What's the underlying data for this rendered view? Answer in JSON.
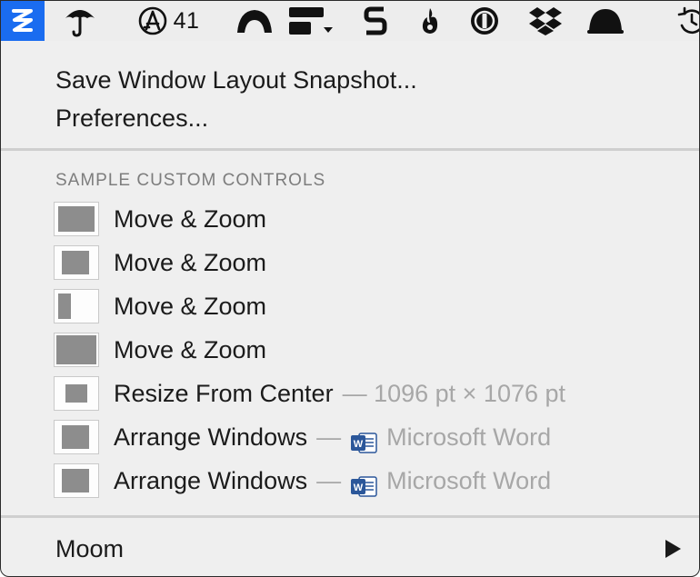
{
  "menubar": {
    "icons": [
      {
        "name": "moom-icon",
        "active": true,
        "accent": "#1a6cf0"
      },
      {
        "name": "umbrella-icon"
      },
      {
        "name": "app-store-icon",
        "badge": "41"
      },
      {
        "name": "arch-icon"
      },
      {
        "name": "display-menu-icon"
      },
      {
        "name": "s-glyph-icon"
      },
      {
        "name": "flame-icon"
      },
      {
        "name": "onepassword-icon"
      },
      {
        "name": "dropbox-icon"
      },
      {
        "name": "notification-bell-icon"
      },
      {
        "name": "time-machine-icon"
      }
    ]
  },
  "menu": {
    "save_snapshot": "Save Window Layout Snapshot...",
    "preferences": "Preferences...",
    "section_title": "SAMPLE CUSTOM CONTROLS",
    "controls": [
      {
        "label": "Move & Zoom",
        "detail": "",
        "app": ""
      },
      {
        "label": "Move & Zoom",
        "detail": "",
        "app": ""
      },
      {
        "label": "Move & Zoom",
        "detail": "",
        "app": ""
      },
      {
        "label": "Move & Zoom",
        "detail": "",
        "app": ""
      },
      {
        "label": "Resize From Center",
        "detail": "— 1096 pt × 1076 pt",
        "app": ""
      },
      {
        "label": "Arrange Windows",
        "detail": "—",
        "app": "Microsoft Word"
      },
      {
        "label": "Arrange Windows",
        "detail": "—",
        "app": "Microsoft Word"
      }
    ],
    "moom_submenu": "Moom"
  }
}
